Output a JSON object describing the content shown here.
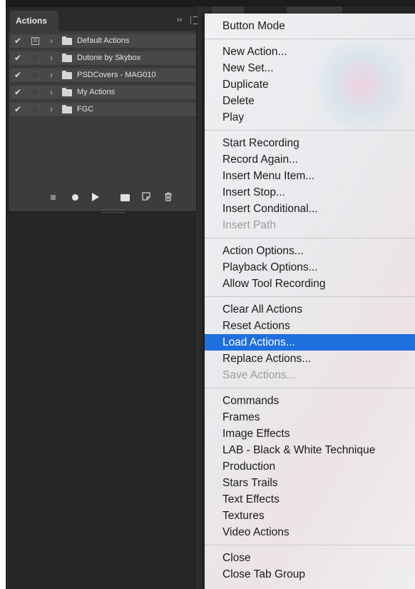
{
  "panel": {
    "tab_label": "Actions",
    "header_icons": [
      "double-chevron-icon",
      "panel-menu-icon"
    ],
    "header_chevrons": "››",
    "actions": [
      {
        "label": "Default Actions",
        "checked": true,
        "dialog_toggle": true
      },
      {
        "label": "Dutone by Skybox",
        "checked": true,
        "dialog_toggle": false
      },
      {
        "label": "PSDCovers - MAG010",
        "checked": true,
        "dialog_toggle": false
      },
      {
        "label": "My Actions",
        "checked": true,
        "dialog_toggle": false
      },
      {
        "label": "FGC",
        "checked": true,
        "dialog_toggle": false
      }
    ],
    "footer_icons": [
      "stop-icon",
      "record-icon",
      "play-icon",
      "new-set-icon",
      "new-action-icon",
      "trash-icon"
    ]
  },
  "menu": {
    "groups": [
      [
        {
          "label": "Button Mode"
        }
      ],
      [
        {
          "label": "New Action..."
        },
        {
          "label": "New Set..."
        },
        {
          "label": "Duplicate"
        },
        {
          "label": "Delete"
        },
        {
          "label": "Play"
        }
      ],
      [
        {
          "label": "Start Recording"
        },
        {
          "label": "Record Again..."
        },
        {
          "label": "Insert Menu Item..."
        },
        {
          "label": "Insert Stop..."
        },
        {
          "label": "Insert Conditional..."
        },
        {
          "label": "Insert Path",
          "disabled": true
        }
      ],
      [
        {
          "label": "Action Options..."
        },
        {
          "label": "Playback Options..."
        },
        {
          "label": "Allow Tool Recording"
        }
      ],
      [
        {
          "label": "Clear All Actions"
        },
        {
          "label": "Reset Actions"
        },
        {
          "label": "Load Actions...",
          "highlighted": true
        },
        {
          "label": "Replace Actions..."
        },
        {
          "label": "Save Actions...",
          "disabled": true
        }
      ],
      [
        {
          "label": "Commands"
        },
        {
          "label": "Frames"
        },
        {
          "label": "Image Effects"
        },
        {
          "label": "LAB - Black & White Technique"
        },
        {
          "label": "Production"
        },
        {
          "label": "Stars Trails"
        },
        {
          "label": "Text Effects"
        },
        {
          "label": "Textures"
        },
        {
          "label": "Video Actions"
        }
      ],
      [
        {
          "label": "Close"
        },
        {
          "label": "Close Tab Group"
        }
      ]
    ]
  },
  "colors": {
    "panel_bg": "#3c3c3c",
    "app_bg": "#262626",
    "menu_highlight": "#1f6fde",
    "disabled_text": "#9c9c9c"
  }
}
